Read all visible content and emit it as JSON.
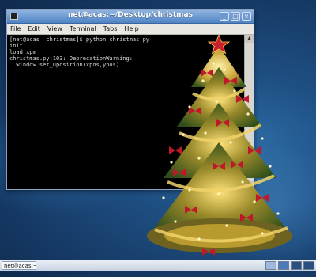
{
  "window": {
    "title": "net@acas:~/Desktop/christmas",
    "menu": [
      "File",
      "Edit",
      "View",
      "Terminal",
      "Tabs",
      "Help"
    ]
  },
  "terminal": {
    "lines": [
      "[net@acas  christmas]$ python christmas.py",
      "init",
      "load xpm",
      "christmas.py:103: DeprecationWarning:",
      "  window.set_uposition(xpos,ypos)"
    ]
  },
  "taskbar": {
    "task_label": "net@acas:~/Desktop/..."
  },
  "icons": {
    "window_close": "close-icon",
    "window_max": "maximize-icon",
    "window_min": "minimize-icon",
    "tree": "christmas-tree-image"
  }
}
